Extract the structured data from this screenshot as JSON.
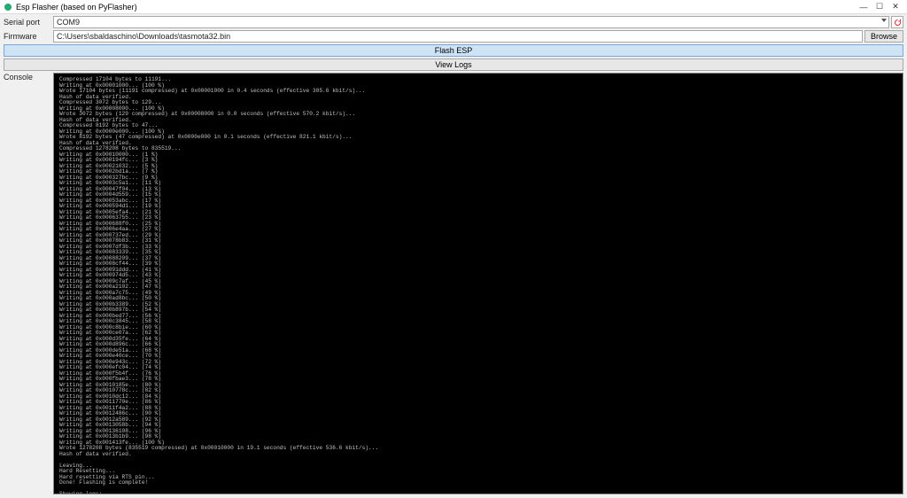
{
  "window": {
    "title": "Esp Flasher (based on PyFlasher)"
  },
  "winControls": {
    "min": "—",
    "max": "☐",
    "close": "✕"
  },
  "labels": {
    "serial": "Serial port",
    "firmware": "Firmware",
    "console": "Console"
  },
  "serial": {
    "value": "COM9"
  },
  "firmware": {
    "path": "C:\\Users\\sbaldaschino\\Downloads\\tasmota32.bin"
  },
  "buttons": {
    "browse": "Browse",
    "flash": "Flash ESP",
    "viewLogs": "View Logs"
  },
  "consoleText": "Compressed 17104 bytes to 11191...\nWriting at 0x00001000... (100 %)\nWrote 17104 bytes (11191 compressed) at 0x00001000 in 0.4 seconds (effective 305.6 kbit/s)...\nHash of data verified.\nCompressed 3072 bytes to 129...\nWriting at 0x00008000... (100 %)\nWrote 3072 bytes (129 compressed) at 0x00008000 in 0.0 seconds (effective 570.2 kbit/s)...\nHash of data verified.\nCompressed 8192 bytes to 47...\nWriting at 0x0000e000... (100 %)\nWrote 8192 bytes (47 compressed) at 0x0000e000 in 0.1 seconds (effective 821.1 kbit/s)...\nHash of data verified.\nCompressed 1278208 bytes to 835519...\nWriting at 0x00010000... (1 %)\nWriting at 0x000194fc... (3 %)\nWriting at 0x00021032... (5 %)\nWriting at 0x0002bd1a... (7 %)\nWriting at 0x000327bc... (9 %)\nWriting at 0x0003c5a1... (11 %)\nWriting at 0x00047f04... (13 %)\nWriting at 0x0004d559... (15 %)\nWriting at 0x00053abc... (17 %)\nWriting at 0x000594d1... (19 %)\nWriting at 0x0005efa4... (21 %)\nWriting at 0x00063755... (23 %)\nWriting at 0x000688f0... (25 %)\nWriting at 0x0006e4aa... (27 %)\nWriting at 0x000737ed... (29 %)\nWriting at 0x00078b83... (31 %)\nWriting at 0x0007df3b... (33 %)\nWriting at 0x00083339... (35 %)\nWriting at 0x00088209... (37 %)\nWriting at 0x0008cf44... (39 %)\nWriting at 0x00091ddd... (41 %)\nWriting at 0x000974d5... (43 %)\nWriting at 0x0009c7af... (45 %)\nWriting at 0x000a2102... (47 %)\nWriting at 0x000a7c75... (49 %)\nWriting at 0x000ad8bc... (50 %)\nWriting at 0x000b3389... (52 %)\nWriting at 0x000b897b... (54 %)\nWriting at 0x000bed77... (56 %)\nWriting at 0x000c3845... (58 %)\nWriting at 0x000c8bie... (60 %)\nWriting at 0x000ce07a... (62 %)\nWriting at 0x000d35fe... (64 %)\nWriting at 0x000d896c... (66 %)\nWriting at 0x000de51a... (68 %)\nWriting at 0x000e40ce... (70 %)\nWriting at 0x000e943c... (72 %)\nWriting at 0x000efc04... (74 %)\nWriting at 0x000f5b4f... (76 %)\nWriting at 0x000fbae3... (78 %)\nWriting at 0x0010185e... (80 %)\nWriting at 0x0010778c... (82 %)\nWriting at 0x0010dc12... (84 %)\nWriting at 0x0011770e... (86 %)\nWriting at 0x0011f4a2... (88 %)\nWriting at 0x0012486c... (90 %)\nWriting at 0x0012a589... (92 %)\nWriting at 0x0013058b... (94 %)\nWriting at 0x00136108... (96 %)\nWriting at 0x0013b1b9... (98 %)\nWriting at 0x001413fe... (100 %)\nWrote 1278208 bytes (835519 compressed) at 0x00010000 in 19.1 seconds (effective 536.6 kbit/s)...\nHash of data verified.\n\nLeaving...\nHard Resetting...\nHard resetting via RTS pin...\nDone! Flashing is complete!\n\nShowing logs:"
}
